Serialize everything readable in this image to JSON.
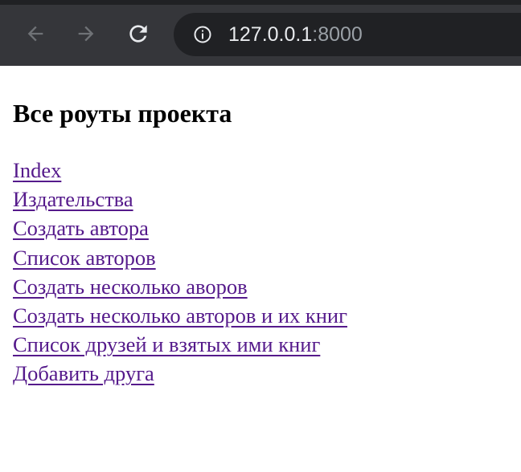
{
  "browser": {
    "url_host": "127.0.0.1",
    "url_port": ":8000",
    "back_icon": "arrow-left-icon",
    "forward_icon": "arrow-right-icon",
    "reload_icon": "reload-icon",
    "info_icon": "info-icon"
  },
  "page": {
    "title": "Все роуты проекта",
    "links": [
      {
        "label": "Index"
      },
      {
        "label": "Издательства"
      },
      {
        "label": "Создать автора"
      },
      {
        "label": "Список авторов"
      },
      {
        "label": "Создать несколько аворов"
      },
      {
        "label": "Создать несколько авторов и их книг"
      },
      {
        "label": "Список друзей и взятых ими книг"
      },
      {
        "label": "Добавить друга"
      }
    ]
  },
  "colors": {
    "toolbar": "#35363a",
    "omnibox": "#202124",
    "visited_link": "#551a8b"
  }
}
